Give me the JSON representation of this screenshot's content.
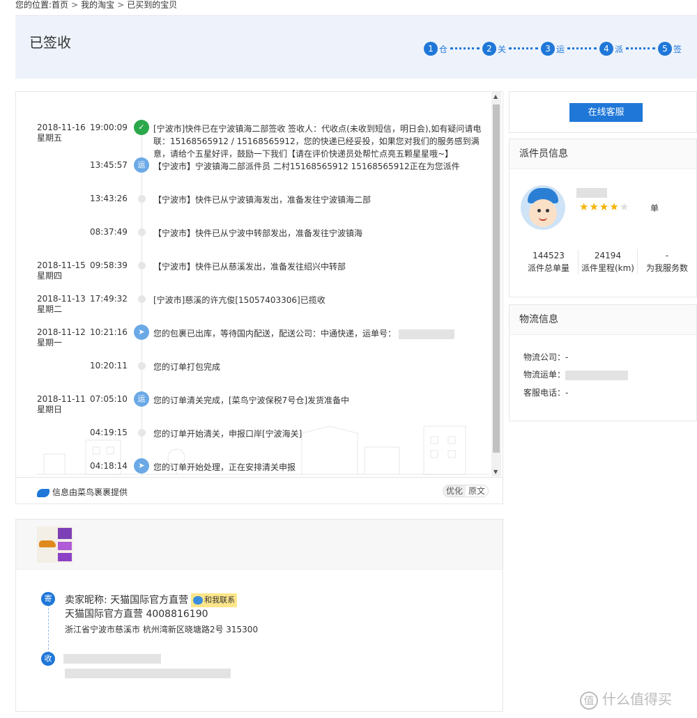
{
  "breadcrumb": {
    "prefix": "您的位置:",
    "items": [
      "首页",
      "我的淘宝",
      "已买到的宝贝"
    ],
    "sep": ">"
  },
  "header": {
    "status": "已签收",
    "steps": [
      {
        "num": "1",
        "label": "仓"
      },
      {
        "num": "2",
        "label": "关"
      },
      {
        "num": "3",
        "label": "运"
      },
      {
        "num": "4",
        "label": "派"
      },
      {
        "num": "5",
        "label": "签"
      }
    ]
  },
  "tracking": {
    "events": [
      {
        "date": "2018-11-16",
        "weekday": "星期五",
        "time": "19:00:09",
        "icon": "check-icon",
        "icon_text": "✓",
        "desc": "[宁波市]快件已在宁波镇海二部签收 签收人：代收点(未收到短信，明日会),如有疑问请电联：15168565912 / 15168565912，您的快递已经妥投，如果您对我们的服务感到满意，请给个五星好评，鼓励一下我们【请在评价快递员处帮忙点亮五颗星星哦~】"
      },
      {
        "date": "",
        "weekday": "",
        "time": "13:45:57",
        "icon": "transport-icon",
        "icon_text": "运",
        "desc": "【宁波市】宁波镇海二部派件员 二村15168565912 15168565912正在为您派件"
      },
      {
        "date": "",
        "weekday": "",
        "time": "13:43:26",
        "icon": "",
        "icon_text": "",
        "desc": "【宁波市】快件已从宁波镇海发出，准备发往宁波镇海二部"
      },
      {
        "date": "",
        "weekday": "",
        "time": "08:37:49",
        "icon": "",
        "icon_text": "",
        "desc": "【宁波市】快件已从宁波中转部发出，准备发往宁波镇海"
      },
      {
        "date": "2018-11-15",
        "weekday": "星期四",
        "time": "09:58:39",
        "icon": "",
        "icon_text": "",
        "desc": "【宁波市】快件已从慈溪发出，准备发往绍兴中转部"
      },
      {
        "date": "2018-11-13",
        "weekday": "星期二",
        "time": "17:49:32",
        "icon": "",
        "icon_text": "",
        "desc": "[宁波市]慈溪的许亢俊[15057403306]已揽收"
      },
      {
        "date": "2018-11-12",
        "weekday": "星期一",
        "time": "10:21:16",
        "icon": "cainiao-bird-icon",
        "icon_text": "",
        "desc": "您的包裹已出库，等待国内配送，配送公司：中通快递，运单号："
      },
      {
        "date": "",
        "weekday": "",
        "time": "10:20:11",
        "icon": "",
        "icon_text": "",
        "desc": "您的订单打包完成"
      },
      {
        "date": "2018-11-11",
        "weekday": "星期日",
        "time": "07:05:10",
        "icon": "transport-icon",
        "icon_text": "运",
        "desc": "您的订单清关完成，[菜鸟宁波保税7号仓]发货准备中"
      },
      {
        "date": "",
        "weekday": "",
        "time": "04:19:15",
        "icon": "",
        "icon_text": "",
        "desc": "您的订单开始清关，申报口岸[宁波海关]"
      },
      {
        "date": "",
        "weekday": "",
        "time": "04:18:14",
        "icon": "cainiao-bird-icon",
        "icon_text": "",
        "desc": "您的订单开始处理，正在安排清关申报"
      }
    ],
    "provider": "信息由菜鸟裹裹提供",
    "toggle": {
      "optimized": "优化",
      "original": "原文"
    }
  },
  "service": {
    "button": "在线客服"
  },
  "courier": {
    "title": "派件员信息",
    "rating": 4,
    "rating_max": 5,
    "unit_label": "单",
    "stats": [
      {
        "value": "144523",
        "label": "派件总单量"
      },
      {
        "value": "24194",
        "label": "派件里程(km)"
      },
      {
        "value": "-",
        "label": "为我服务数"
      }
    ]
  },
  "logistics": {
    "title": "物流信息",
    "company_label": "物流公司：",
    "company_value": "-",
    "waybill_label": "物流运单：",
    "phone_label": "客服电话：",
    "phone_value": "-"
  },
  "order": {
    "send_badge": "寄",
    "recv_badge": "收",
    "seller_label": "卖家昵称: 天猫国际官方直营",
    "contact": "和我联系",
    "seller_line2": "天猫国际官方直营 4008816190",
    "seller_addr": "浙江省宁波市慈溪市 杭州湾新区晓塘路2号 315300"
  },
  "watermark": {
    "logo": "值",
    "text": "什么值得买"
  },
  "colors": {
    "accent": "#1f77d8",
    "success": "#2ba84a",
    "header_bg": "#eef3fb"
  }
}
